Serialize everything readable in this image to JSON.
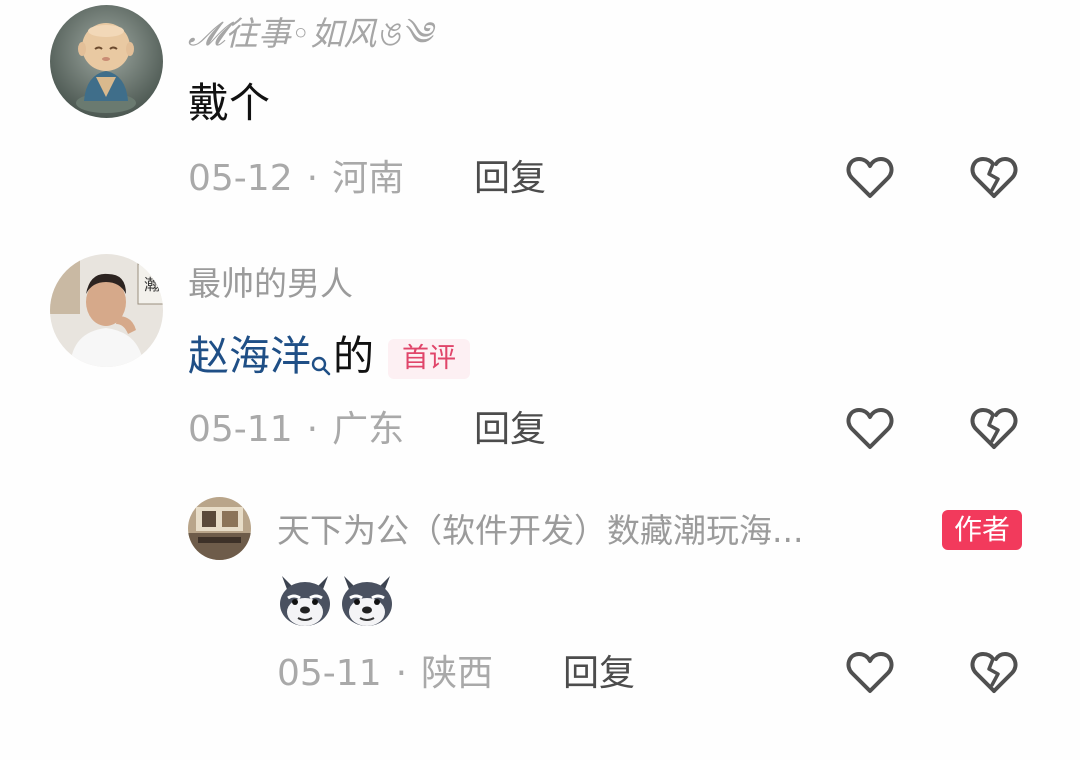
{
  "comments": [
    {
      "username": "𝓜往事◦如风ঙ༄",
      "text": "戴个",
      "date": "05-12",
      "separator": "·",
      "location": "河南",
      "reply_label": "回复"
    },
    {
      "username": "最帅的男人",
      "mention": "赵海洋",
      "text_after": "的",
      "badge": "首评",
      "date": "05-11",
      "separator": "·",
      "location": "广东",
      "reply_label": "回复"
    }
  ],
  "reply": {
    "username": "天下为公（软件开发）数藏潮玩海...",
    "badge": "作者",
    "emojis": [
      "husky-emoji",
      "husky-emoji"
    ],
    "date": "05-11",
    "separator": "·",
    "location": "陕西",
    "reply_label": "回复"
  },
  "colors": {
    "meta_gray": "#a9a9a9",
    "username_gray": "#9b9b9b",
    "link_blue": "#1f4f86",
    "author_badge": "#f23a5c",
    "first_badge_text": "#e0456a"
  },
  "icons": [
    "like-heart-icon",
    "dislike-broken-heart-icon",
    "search-icon"
  ]
}
